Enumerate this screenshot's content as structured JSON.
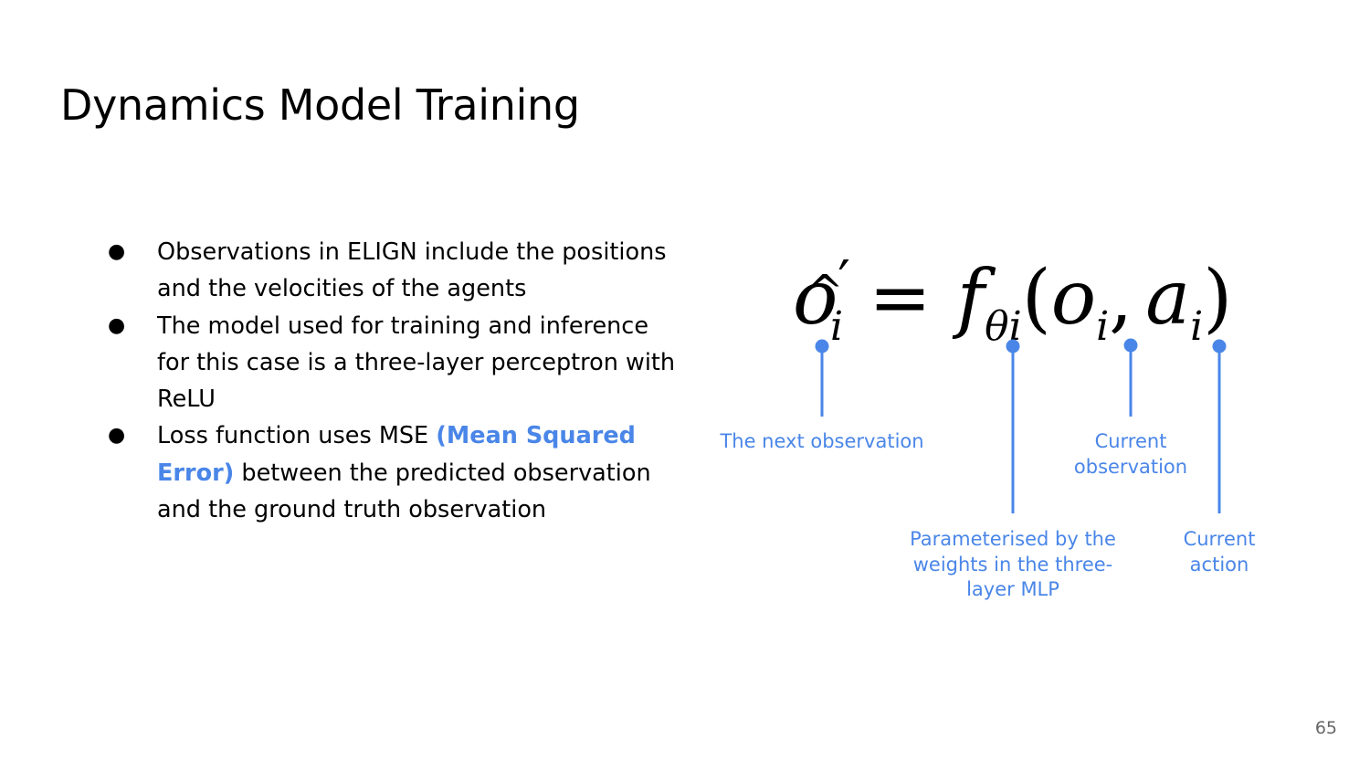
{
  "slide": {
    "title": "Dynamics Model Training",
    "page_number": "65"
  },
  "bullets": [
    {
      "text": "Observations in ELIGN include the positions and the velocities of the agents"
    },
    {
      "text": "The model used for training and inference for this case is a three-layer perceptron with ReLU"
    },
    {
      "text_before": "Loss function uses MSE ",
      "highlight": "(Mean Squared Error)",
      "text_after": " between the predicted observation and the ground truth observation"
    }
  ],
  "bullet_symbol": "●",
  "equation": {
    "lhs_base": "o",
    "lhs_prime": "′",
    "lhs_sub": "i",
    "equals": "=",
    "func": "f",
    "func_sub": "θi",
    "open_paren": "(",
    "arg1_base": "o",
    "arg1_sub": "i",
    "comma": ",",
    "arg2_base": "a",
    "arg2_sub": "i",
    "close_paren": ")"
  },
  "annotations": [
    {
      "id": "next-observation",
      "label": "The next observation"
    },
    {
      "id": "current-observation",
      "label": "Current\nobservation"
    },
    {
      "id": "parameterised",
      "label": "Parameterised by the\nweights in the three-\nlayer MLP"
    },
    {
      "id": "current-action",
      "label": "Current\naction"
    }
  ],
  "colors": {
    "accent": "#4a86e8",
    "text": "#000000",
    "page_number": "#666666",
    "background": "#ffffff"
  }
}
